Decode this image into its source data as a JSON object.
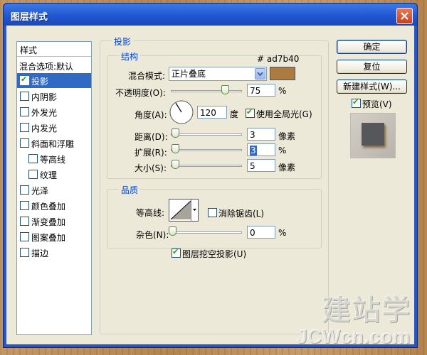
{
  "window": {
    "title": "图层样式"
  },
  "style_list": {
    "header": "样式",
    "blend_options": "混合选项:默认",
    "items": [
      {
        "label": "投影",
        "checked": true
      },
      {
        "label": "内阴影",
        "checked": false
      },
      {
        "label": "外发光",
        "checked": false
      },
      {
        "label": "内发光",
        "checked": false
      },
      {
        "label": "斜面和浮雕",
        "checked": false
      },
      {
        "label": "等高线",
        "checked": false
      },
      {
        "label": "纹理",
        "checked": false
      },
      {
        "label": "光泽",
        "checked": false
      },
      {
        "label": "颜色叠加",
        "checked": false
      },
      {
        "label": "渐变叠加",
        "checked": false
      },
      {
        "label": "图案叠加",
        "checked": false
      },
      {
        "label": "描边",
        "checked": false
      }
    ]
  },
  "drop_shadow": {
    "title": "投影",
    "structure": {
      "title": "结构",
      "color_hex": "# ad7b40",
      "color": "#ad7b40",
      "blend_mode_label": "混合模式:",
      "blend_mode_value": "正片叠底",
      "opacity_label": "不透明度(O):",
      "opacity_value": "75",
      "opacity_unit": "%",
      "angle_label": "角度(A):",
      "angle_value": "120",
      "angle_unit": "度",
      "global_light_label": "使用全局光(G)",
      "global_light_checked": true,
      "distance_label": "距离(D):",
      "distance_value": "3",
      "distance_unit": "像素",
      "spread_label": "扩展(R):",
      "spread_value": "3",
      "spread_unit": "%",
      "size_label": "大小(S):",
      "size_value": "5",
      "size_unit": "像素"
    },
    "quality": {
      "title": "品质",
      "contour_label": "等高线:",
      "anti_alias_label": "消除锯齿(L)",
      "anti_alias_checked": false,
      "noise_label": "杂色(N):",
      "noise_value": "0",
      "noise_unit": "%"
    },
    "knockout_label": "图层挖空投影(U)",
    "knockout_checked": true
  },
  "buttons": {
    "ok": "确定",
    "reset": "复位",
    "new_style": "新建样式(W)...",
    "preview_label": "预览(V)",
    "preview_checked": true
  },
  "watermark": {
    "logo_text": "建站学",
    "site_text": "JCWcn.com"
  },
  "colors": {
    "title_bar": "#2a56c4",
    "dialog_bg": "#ece9d8",
    "selection": "#316ac5",
    "shadow_color": "#ad7b40"
  }
}
